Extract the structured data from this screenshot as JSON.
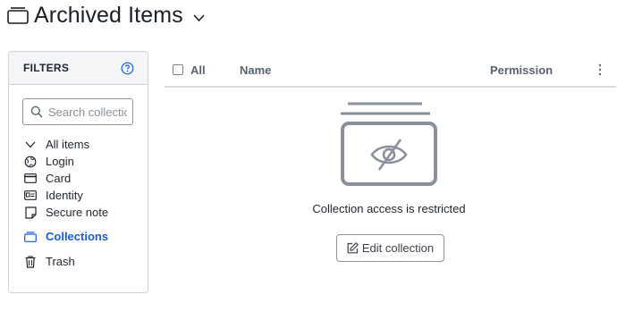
{
  "header": {
    "title": "Archived Items"
  },
  "filters": {
    "title": "FILTERS",
    "search": {
      "placeholder": "Search collections",
      "value": ""
    },
    "items": [
      {
        "label": "All items",
        "icon": "chevron-down-icon",
        "active": false
      },
      {
        "label": "Login",
        "icon": "globe-icon",
        "active": false
      },
      {
        "label": "Card",
        "icon": "credit-card-icon",
        "active": false
      },
      {
        "label": "Identity",
        "icon": "id-card-icon",
        "active": false
      },
      {
        "label": "Secure note",
        "icon": "note-icon",
        "active": false
      },
      {
        "label": "Collections",
        "icon": "collection-icon",
        "active": true
      },
      {
        "label": "Trash",
        "icon": "trash-icon",
        "active": false
      }
    ]
  },
  "table": {
    "columns": {
      "select_all": "All",
      "name": "Name",
      "permission": "Permission"
    }
  },
  "empty_state": {
    "message": "Collection access is restricted",
    "icon": "collection-hidden-icon",
    "button_label": "Edit collection",
    "button_icon": "edit-icon"
  },
  "colors": {
    "accent": "#175ddc",
    "icon_gray": "#8a909b",
    "border": "#cfd3d8"
  }
}
